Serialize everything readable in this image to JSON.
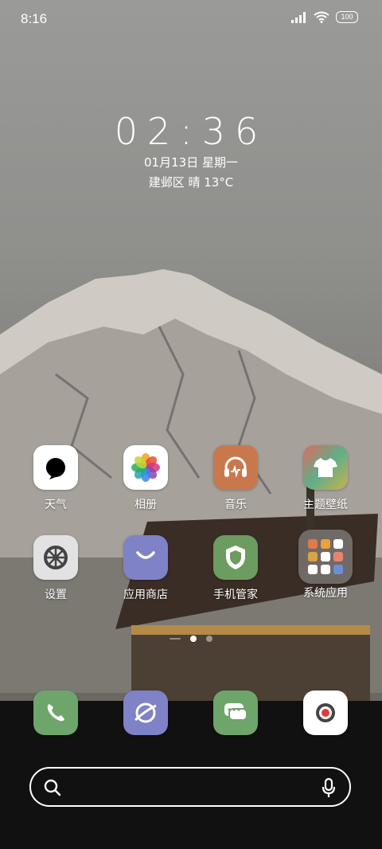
{
  "status_bar": {
    "time": "8:16",
    "battery": "100",
    "icons": [
      "signal-icon",
      "wifi-icon",
      "battery-icon"
    ]
  },
  "lock_widget": {
    "time": "02:36",
    "date": "01月13日 星期一",
    "weather": "建邺区 晴 13°C"
  },
  "apps": [
    {
      "label": "天气",
      "icon": "weather-icon",
      "color": "#ffffff"
    },
    {
      "label": "相册",
      "icon": "gallery-icon",
      "color": "#ffffff"
    },
    {
      "label": "音乐",
      "icon": "music-icon",
      "color": "#c9784e"
    },
    {
      "label": "主题壁纸",
      "icon": "themes-icon",
      "color": "#5fae8a"
    },
    {
      "label": "设置",
      "icon": "settings-icon",
      "color": "#e2e2e2"
    },
    {
      "label": "应用商店",
      "icon": "app-store-icon",
      "color": "#7f82c6"
    },
    {
      "label": "手机管家",
      "icon": "security-icon",
      "color": "#6c9c5f"
    },
    {
      "label": "系统应用",
      "icon": "folder-icon",
      "color": "#7a7672"
    }
  ],
  "dock": [
    {
      "icon": "phone-icon",
      "color": "#6ea56a"
    },
    {
      "icon": "browser-icon",
      "color": "#7f82c6"
    },
    {
      "icon": "messages-icon",
      "color": "#6ea56a"
    },
    {
      "icon": "camera-icon",
      "color": "#ffffff"
    }
  ],
  "page_indicator": {
    "pages": 2,
    "active": 0
  },
  "search": {
    "icons": [
      "search-icon",
      "microphone-icon"
    ]
  }
}
